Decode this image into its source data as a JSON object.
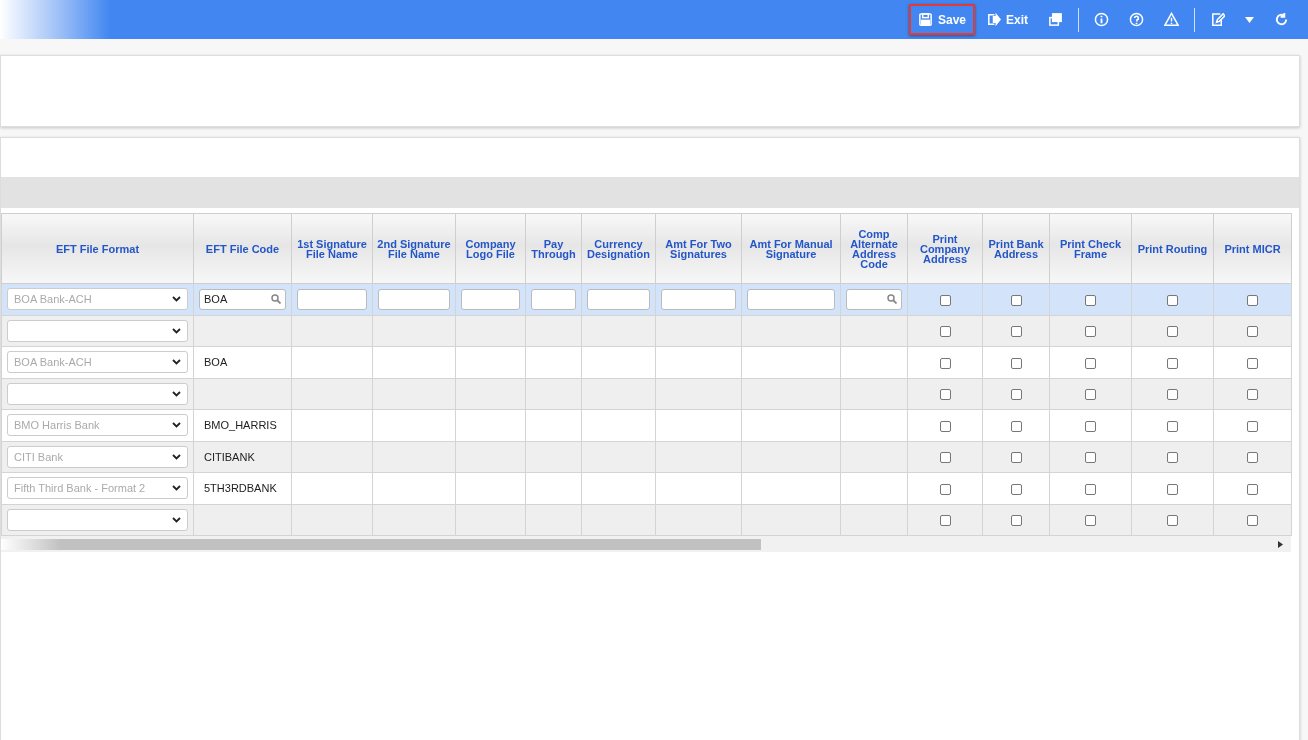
{
  "toolbar": {
    "buttons": [
      {
        "kind": "save",
        "label": "Save",
        "highlighted": true
      },
      {
        "kind": "exit",
        "label": "Exit",
        "highlighted": false
      },
      {
        "kind": "copy",
        "highlighted": false
      },
      {
        "kind": "sep"
      },
      {
        "kind": "info",
        "highlighted": false
      },
      {
        "kind": "help",
        "highlighted": false
      },
      {
        "kind": "warning",
        "highlighted": false
      },
      {
        "kind": "sep"
      },
      {
        "kind": "edit",
        "highlighted": false
      },
      {
        "kind": "caret",
        "highlighted": false
      },
      {
        "kind": "refresh",
        "highlighted": false
      }
    ]
  },
  "table": {
    "columns": [
      "EFT File Format",
      "EFT File Code",
      "1st Signature File Name",
      "2nd Signature File Name",
      "Company Logo File",
      "Pay Through",
      "Currency Designation",
      "Amt For Two Signatures",
      "Amt For Manual Signature",
      "Comp Alternate Address Code",
      "Print Company Address",
      "Print Bank Address",
      "Print Check Frame",
      "Print Routing",
      "Print MICR"
    ],
    "rows": [
      {
        "kind": "edit",
        "selected": true,
        "format": "BOA Bank-ACH",
        "code": "BOA",
        "checks": [
          false,
          false,
          false,
          false,
          false
        ]
      },
      {
        "kind": "view",
        "selected": false,
        "format": "",
        "code": "",
        "checks": [
          false,
          false,
          false,
          false,
          false
        ]
      },
      {
        "kind": "view",
        "selected": false,
        "format": "BOA Bank-ACH",
        "code": "BOA",
        "checks": [
          false,
          false,
          false,
          false,
          false
        ]
      },
      {
        "kind": "view",
        "selected": false,
        "format": "",
        "code": "",
        "checks": [
          false,
          false,
          false,
          false,
          false
        ]
      },
      {
        "kind": "view",
        "selected": false,
        "format": "BMO Harris Bank",
        "code": "BMO_HARRIS",
        "checks": [
          false,
          false,
          false,
          false,
          false
        ]
      },
      {
        "kind": "view",
        "selected": false,
        "format": "CITI Bank",
        "code": "CITIBANK",
        "checks": [
          false,
          false,
          false,
          false,
          false
        ]
      },
      {
        "kind": "view",
        "selected": false,
        "format": "Fifth Third Bank - Format 2",
        "code": "5TH3RDBANK",
        "checks": [
          false,
          false,
          false,
          false,
          false
        ]
      },
      {
        "kind": "view",
        "selected": false,
        "format": "",
        "code": "",
        "checks": [
          false,
          false,
          false,
          false,
          false
        ]
      }
    ]
  }
}
